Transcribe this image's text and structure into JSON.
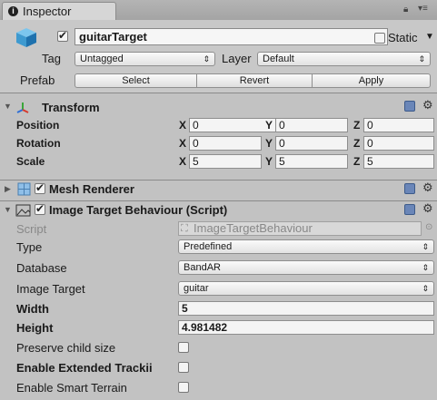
{
  "tab": {
    "label": "Inspector"
  },
  "object": {
    "name": "guitarTarget",
    "active": true,
    "static_label": "Static",
    "static_checked": false,
    "tag_label": "Tag",
    "tag_value": "Untagged",
    "layer_label": "Layer",
    "layer_value": "Default",
    "prefab_label": "Prefab",
    "prefab_buttons": [
      "Select",
      "Revert",
      "Apply"
    ]
  },
  "transform": {
    "title": "Transform",
    "rows": [
      {
        "label": "Position",
        "x": "0",
        "y": "0",
        "z": "0"
      },
      {
        "label": "Rotation",
        "x": "0",
        "y": "0",
        "z": "0"
      },
      {
        "label": "Scale",
        "x": "5",
        "y": "5",
        "z": "5"
      }
    ],
    "axes": [
      "X",
      "Y",
      "Z"
    ]
  },
  "mesh_renderer": {
    "title": "Mesh Renderer",
    "enabled": true
  },
  "image_target": {
    "title": "Image Target Behaviour (Script)",
    "enabled": true,
    "script_label": "Script",
    "script_value": "ImageTargetBehaviour",
    "type_label": "Type",
    "type_value": "Predefined",
    "database_label": "Database",
    "database_value": "BandAR",
    "image_target_label": "Image Target",
    "image_target_value": "guitar",
    "width_label": "Width",
    "width_value": "5",
    "height_label": "Height",
    "height_value": "4.981482",
    "preserve_label": "Preserve child size",
    "extended_label": "Enable Extended Trackii",
    "smart_label": "Enable Smart Terrain"
  }
}
